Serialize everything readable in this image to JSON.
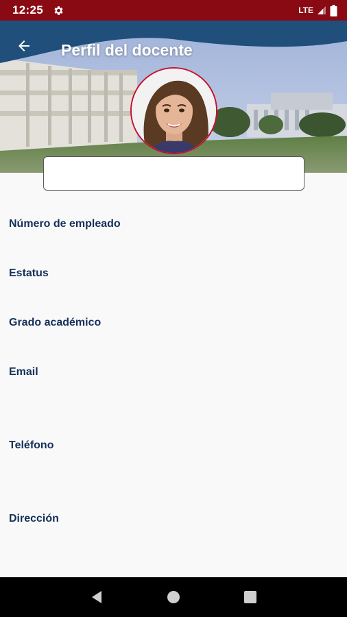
{
  "status_bar": {
    "time": "12:25",
    "network": "LTE",
    "icons": [
      "gear-icon",
      "signal-icon",
      "battery-icon"
    ]
  },
  "header": {
    "title": "Perfil del docente",
    "back_icon": "arrow-left-icon",
    "avatar_description": "teacher-photo"
  },
  "name_field": {
    "value": ""
  },
  "fields": {
    "employee_number_label": "Número de empleado",
    "status_label": "Estatus",
    "degree_label": "Grado académico",
    "email_label": "Email",
    "phone_label": "Teléfono",
    "address_label": "Dirección"
  },
  "nav_bar": {
    "icons": [
      "back-triangle-icon",
      "home-circle-icon",
      "recents-square-icon"
    ]
  },
  "colors": {
    "status_bar": "#8a0a14",
    "header_band": "#1f4f7a",
    "label_text": "#15305a",
    "avatar_border": "#c8102e"
  }
}
